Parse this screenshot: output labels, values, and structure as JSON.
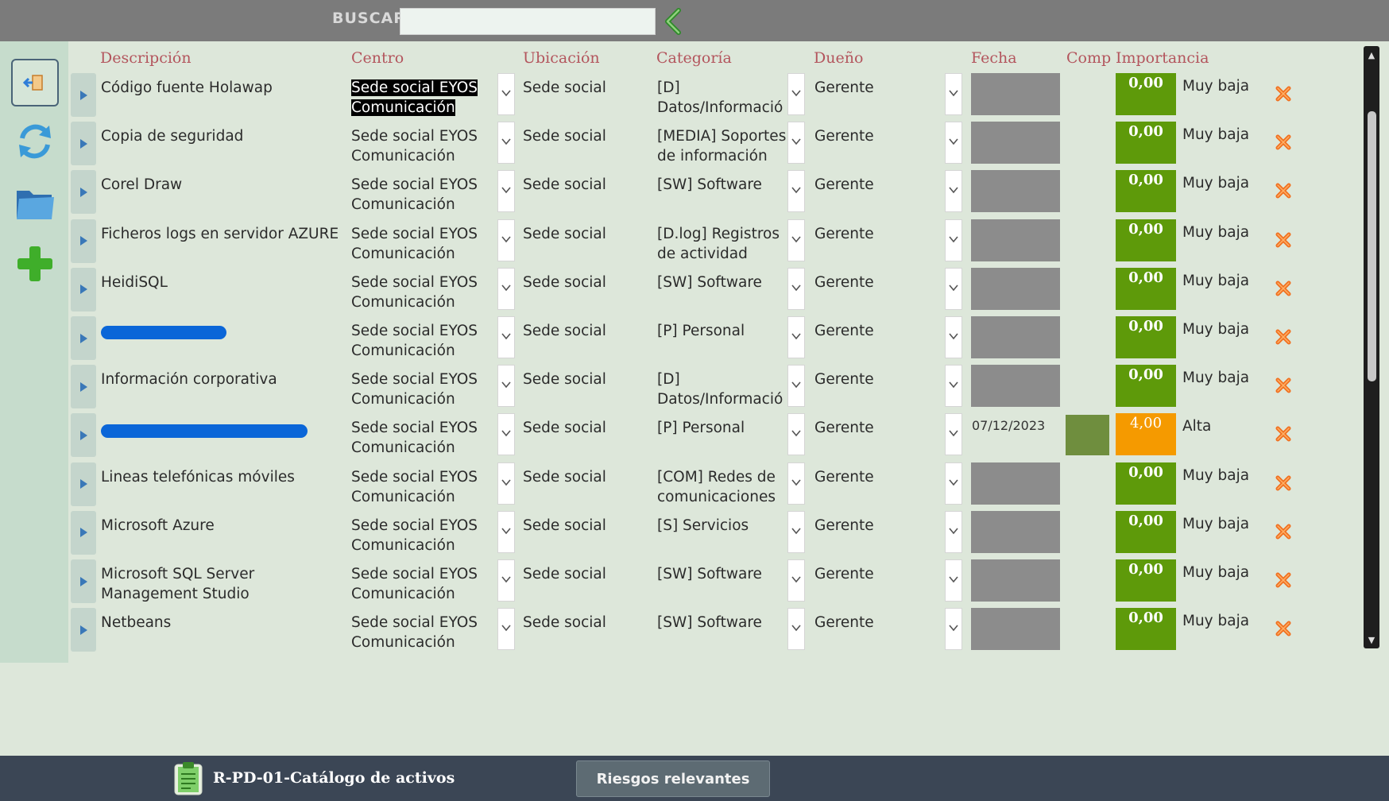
{
  "toolbar": {
    "search_label": "BUSCAR",
    "search_value": "",
    "back_icon": "chevron-left-icon"
  },
  "sidebar": {
    "buttons": [
      {
        "name": "exit-button",
        "icon": "exit-door-icon"
      },
      {
        "name": "refresh-button",
        "icon": "refresh-arrows-icon"
      },
      {
        "name": "folder-button",
        "icon": "folder-icon"
      },
      {
        "name": "add-button",
        "icon": "plus-icon"
      }
    ]
  },
  "columns": {
    "descripcion": "Descripción",
    "centro": "Centro",
    "ubicacion": "Ubicación",
    "categoria": "Categoría",
    "dueno": "Dueño",
    "fecha": "Fecha",
    "comp": "Comp",
    "importancia": "Importancia"
  },
  "rows": [
    {
      "descripcion": "Código fuente Holawap",
      "centro_1": "Sede social EYOS",
      "centro_2": "Comunicación",
      "ubicacion": "Sede social",
      "cat_1": "[D]",
      "cat_2": "Datos/Informació",
      "dueno": "Gerente",
      "fecha": "",
      "importancia": "0,00",
      "nivel": "Muy baja",
      "redacted": false,
      "selected": true
    },
    {
      "descripcion": "Copia de seguridad",
      "centro_1": "Sede social EYOS",
      "centro_2": "Comunicación",
      "ubicacion": "Sede social",
      "cat_1": "[MEDIA] Soportes",
      "cat_2": "de información",
      "dueno": "Gerente",
      "fecha": "",
      "importancia": "0,00",
      "nivel": "Muy baja",
      "redacted": false
    },
    {
      "descripcion": "Corel Draw",
      "centro_1": "Sede social EYOS",
      "centro_2": "Comunicación",
      "ubicacion": "Sede social",
      "cat_1": "[SW] Software",
      "cat_2": "",
      "dueno": "Gerente",
      "fecha": "",
      "importancia": "0,00",
      "nivel": "Muy baja",
      "redacted": false
    },
    {
      "descripcion": "Ficheros logs en servidor AZURE",
      "centro_1": "Sede social EYOS",
      "centro_2": "Comunicación",
      "ubicacion": "Sede social",
      "cat_1": "[D.log] Registros",
      "cat_2": "de actividad",
      "dueno": "Gerente",
      "fecha": "",
      "importancia": "0,00",
      "nivel": "Muy baja",
      "redacted": false
    },
    {
      "descripcion": "HeidiSQL",
      "centro_1": "Sede social EYOS",
      "centro_2": "Comunicación",
      "ubicacion": "Sede social",
      "cat_1": "[SW] Software",
      "cat_2": "",
      "dueno": "Gerente",
      "fecha": "",
      "importancia": "0,00",
      "nivel": "Muy baja",
      "redacted": false
    },
    {
      "descripcion": "",
      "centro_1": "Sede social EYOS",
      "centro_2": "Comunicación",
      "ubicacion": "Sede social",
      "cat_1": "[P] Personal",
      "cat_2": "",
      "dueno": "Gerente",
      "fecha": "",
      "importancia": "0,00",
      "nivel": "Muy baja",
      "redacted": true
    },
    {
      "descripcion": "Información corporativa",
      "centro_1": "Sede social EYOS",
      "centro_2": "Comunicación",
      "ubicacion": "Sede social",
      "cat_1": "[D]",
      "cat_2": "Datos/Informació",
      "dueno": "Gerente",
      "fecha": "",
      "importancia": "0,00",
      "nivel": "Muy baja",
      "redacted": false
    },
    {
      "descripcion": "",
      "centro_1": "Sede social EYOS",
      "centro_2": "Comunicación",
      "ubicacion": "Sede social",
      "cat_1": "[P] Personal",
      "cat_2": "",
      "dueno": "Gerente",
      "fecha": "07/12/2023",
      "importancia": "4,00",
      "nivel": "Alta",
      "redacted": true,
      "alert": true
    },
    {
      "descripcion": "Lineas telefónicas móviles",
      "centro_1": "Sede social EYOS",
      "centro_2": "Comunicación",
      "ubicacion": "Sede social",
      "cat_1": "[COM] Redes de",
      "cat_2": "comunicaciones",
      "dueno": "Gerente",
      "fecha": "",
      "importancia": "0,00",
      "nivel": "Muy baja",
      "redacted": false
    },
    {
      "descripcion": "Microsoft Azure",
      "centro_1": "Sede social EYOS",
      "centro_2": "Comunicación",
      "ubicacion": "Sede social",
      "cat_1": "[S] Servicios",
      "cat_2": "",
      "dueno": "Gerente",
      "fecha": "",
      "importancia": "0,00",
      "nivel": "Muy baja",
      "redacted": false
    },
    {
      "descripcion": "Microsoft SQL Server Management Studio",
      "centro_1": "Sede social EYOS",
      "centro_2": "Comunicación",
      "ubicacion": "Sede social",
      "cat_1": "[SW] Software",
      "cat_2": "",
      "dueno": "Gerente",
      "fecha": "",
      "importancia": "0,00",
      "nivel": "Muy baja",
      "redacted": false
    },
    {
      "descripcion": "Netbeans",
      "centro_1": "Sede social EYOS",
      "centro_2": "Comunicación",
      "ubicacion": "Sede social",
      "cat_1": "[SW] Software",
      "cat_2": "",
      "dueno": "Gerente",
      "fecha": "",
      "importancia": "0,00",
      "nivel": "Muy baja",
      "redacted": false
    }
  ],
  "footer": {
    "doc_title": "R-PD-01-Catálogo de activos",
    "tab_label": "Riesgos relevantes",
    "doc_icon": "clipboard-icon"
  },
  "colors": {
    "background": "#dde7da",
    "header_text": "#b3555d",
    "importance_low": "#5e9a0a",
    "importance_high": "#f59a00",
    "delete": "#f07020"
  }
}
